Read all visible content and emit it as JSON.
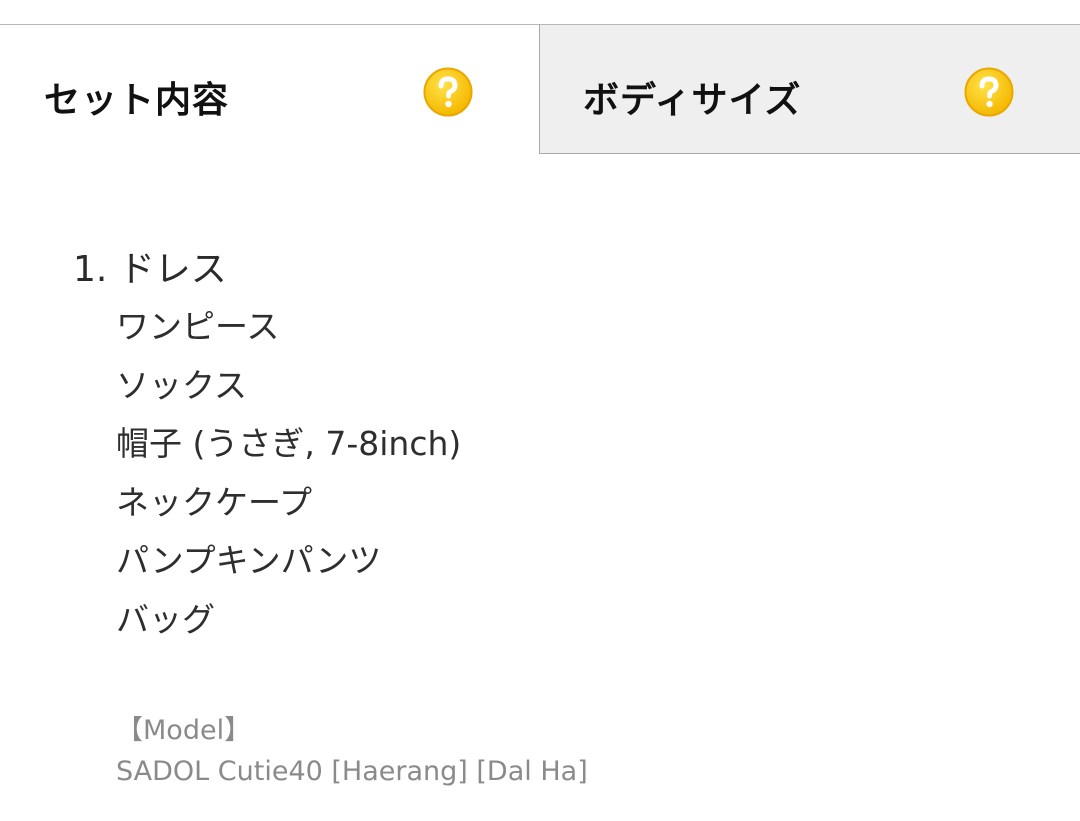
{
  "tabs": [
    {
      "label": "セット内容",
      "active": true,
      "help_icon": "question-circle-icon"
    },
    {
      "label": "ボディサイズ",
      "active": false,
      "help_icon": "question-circle-icon"
    }
  ],
  "colors": {
    "help_icon_fill": "#FFD000",
    "help_icon_ring": "#E8A800",
    "inactive_tab_bg": "#EFEFEF",
    "muted_text": "#8A8A8A"
  },
  "content": {
    "item_heading": "1. ドレス",
    "sub_items": [
      "ワンピース",
      "ソックス",
      "帽子 (うさぎ, 7-8inch)",
      "ネックケープ",
      "パンプキンパンツ",
      "バッグ"
    ],
    "model_label": "【Model】",
    "model_name": "SADOL Cutie40 [Haerang] [Dal Ha]"
  }
}
